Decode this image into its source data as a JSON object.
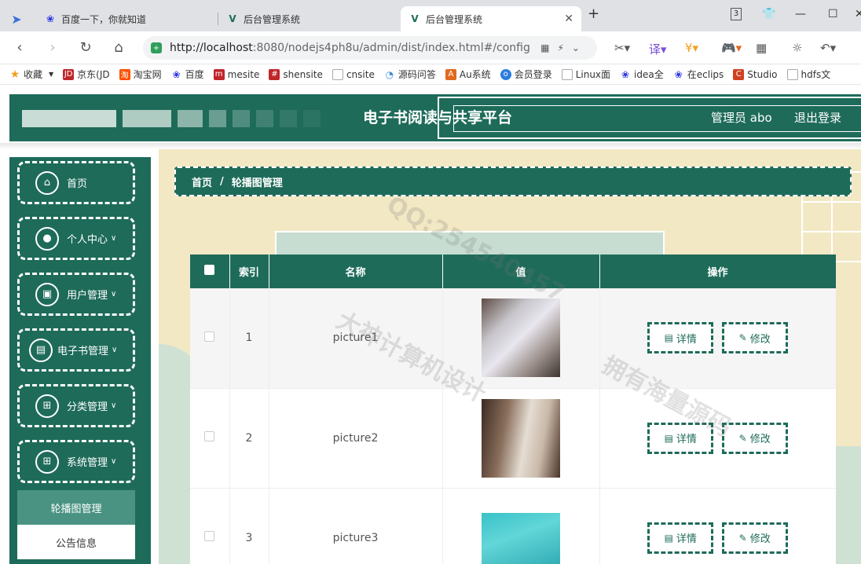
{
  "browser": {
    "tabs": [
      {
        "title": "百度一下，你就知道",
        "icon": "baidu-paw-icon"
      },
      {
        "title": "后台管理系统",
        "icon": "vue-logo-icon"
      },
      {
        "title": "后台管理系统",
        "icon": "vue-logo-icon",
        "active": true
      }
    ],
    "tab_count": "3",
    "url_host": "http://localhost",
    "url_rest": ":8080/nodejs4ph8u/admin/dist/index.html#/config",
    "bookmarks": [
      {
        "label": "收藏",
        "icon": "star-icon",
        "color": "#f0a020"
      },
      {
        "label": "京东(JD",
        "icon": "jd-icon",
        "color": "#c0262a"
      },
      {
        "label": "淘宝网",
        "icon": "taobao-icon",
        "color": "#ff5000"
      },
      {
        "label": "百度",
        "icon": "baidu-paw-icon",
        "color": "#2932e1"
      },
      {
        "label": "mesite",
        "icon": "mesite-icon",
        "color": "#c0262a"
      },
      {
        "label": "shensite",
        "icon": "shensite-icon",
        "color": "#c0262a"
      },
      {
        "label": "cnsite",
        "icon": "page-icon",
        "color": "#888888"
      },
      {
        "label": "源码问答",
        "icon": "source-qa-icon",
        "color": "#3d8de0"
      },
      {
        "label": "Au系统",
        "icon": "au-icon",
        "color": "#e06a20"
      },
      {
        "label": "会员登录",
        "icon": "member-icon",
        "color": "#2b7de0"
      },
      {
        "label": "Linux面",
        "icon": "page-icon",
        "color": "#888888"
      },
      {
        "label": "idea全",
        "icon": "baidu-paw-icon",
        "color": "#2932e1"
      },
      {
        "label": "在eclips",
        "icon": "baidu-paw-icon",
        "color": "#2932e1"
      },
      {
        "label": "Studio",
        "icon": "studio-icon",
        "color": "#d04020"
      },
      {
        "label": "hdfs文",
        "icon": "page-icon",
        "color": "#888888"
      }
    ]
  },
  "header": {
    "title": "电子书阅读与共享平台",
    "user": "管理员 abo",
    "logout": "退出登录"
  },
  "sidebar": {
    "items": [
      {
        "label": "首页",
        "icon": "home-icon",
        "has_chevron": false
      },
      {
        "label": "个人中心",
        "icon": "user-icon",
        "has_chevron": true
      },
      {
        "label": "用户管理",
        "icon": "briefcase-icon",
        "has_chevron": true
      },
      {
        "label": "电子书管理",
        "icon": "clipboard-icon",
        "has_chevron": true
      },
      {
        "label": "分类管理",
        "icon": "grid-icon",
        "has_chevron": true
      },
      {
        "label": "系统管理",
        "icon": "grid-icon",
        "has_chevron": true
      }
    ],
    "submenu": [
      {
        "label": "轮播图管理",
        "active": true
      },
      {
        "label": "公告信息",
        "active": false
      }
    ]
  },
  "breadcrumb": {
    "home": "首页",
    "separator": "/",
    "current": "轮播图管理"
  },
  "table": {
    "columns": [
      "",
      "索引",
      "名称",
      "值",
      "操作"
    ],
    "rows": [
      {
        "index": "1",
        "name": "picture1",
        "image": "book-photo-1"
      },
      {
        "index": "2",
        "name": "picture2",
        "image": "book-photo-2"
      },
      {
        "index": "3",
        "name": "picture3",
        "image": "book-photo-3"
      }
    ],
    "detail_label": "详情",
    "edit_label": "修改"
  },
  "watermarks": [
    "大神计算机设计",
    "拥有海量源码",
    "QQ:254540457"
  ],
  "colors": {
    "primary": "#1e6b5a",
    "accent_light": "#4a9383",
    "background": "#f2e8c4"
  }
}
